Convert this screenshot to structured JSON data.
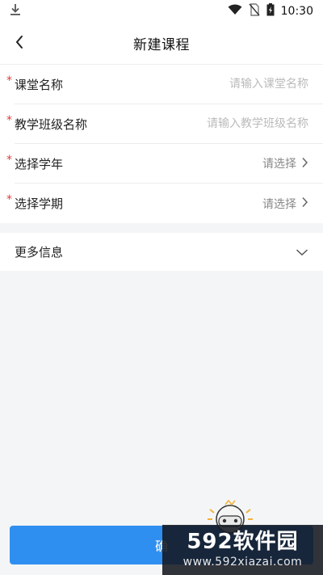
{
  "status_bar": {
    "time": "10:30",
    "icons": [
      "download-icon",
      "wifi-icon",
      "no-sim-icon",
      "battery-charging-icon"
    ]
  },
  "header": {
    "title": "新建课程",
    "back_icon": "chevron-left-icon"
  },
  "form": {
    "required_mark": "*",
    "classroom_name": {
      "label": "课堂名称",
      "placeholder": "请输入课堂名称",
      "value": ""
    },
    "class_name": {
      "label": "教学班级名称",
      "placeholder": "请输入教学班级名称",
      "value": ""
    },
    "school_year": {
      "label": "选择学年",
      "value": "请选择"
    },
    "semester": {
      "label": "选择学期",
      "value": "请选择"
    }
  },
  "more_info": {
    "label": "更多信息",
    "icon": "chevron-down-icon"
  },
  "submit": {
    "label": "确"
  },
  "watermark": {
    "logo_number": "592",
    "logo_text": "软件园",
    "url": "www.592xiazai.com"
  },
  "colors": {
    "primary": "#2f8ff0",
    "required": "#e23a3a",
    "background": "#f4f5f7"
  }
}
